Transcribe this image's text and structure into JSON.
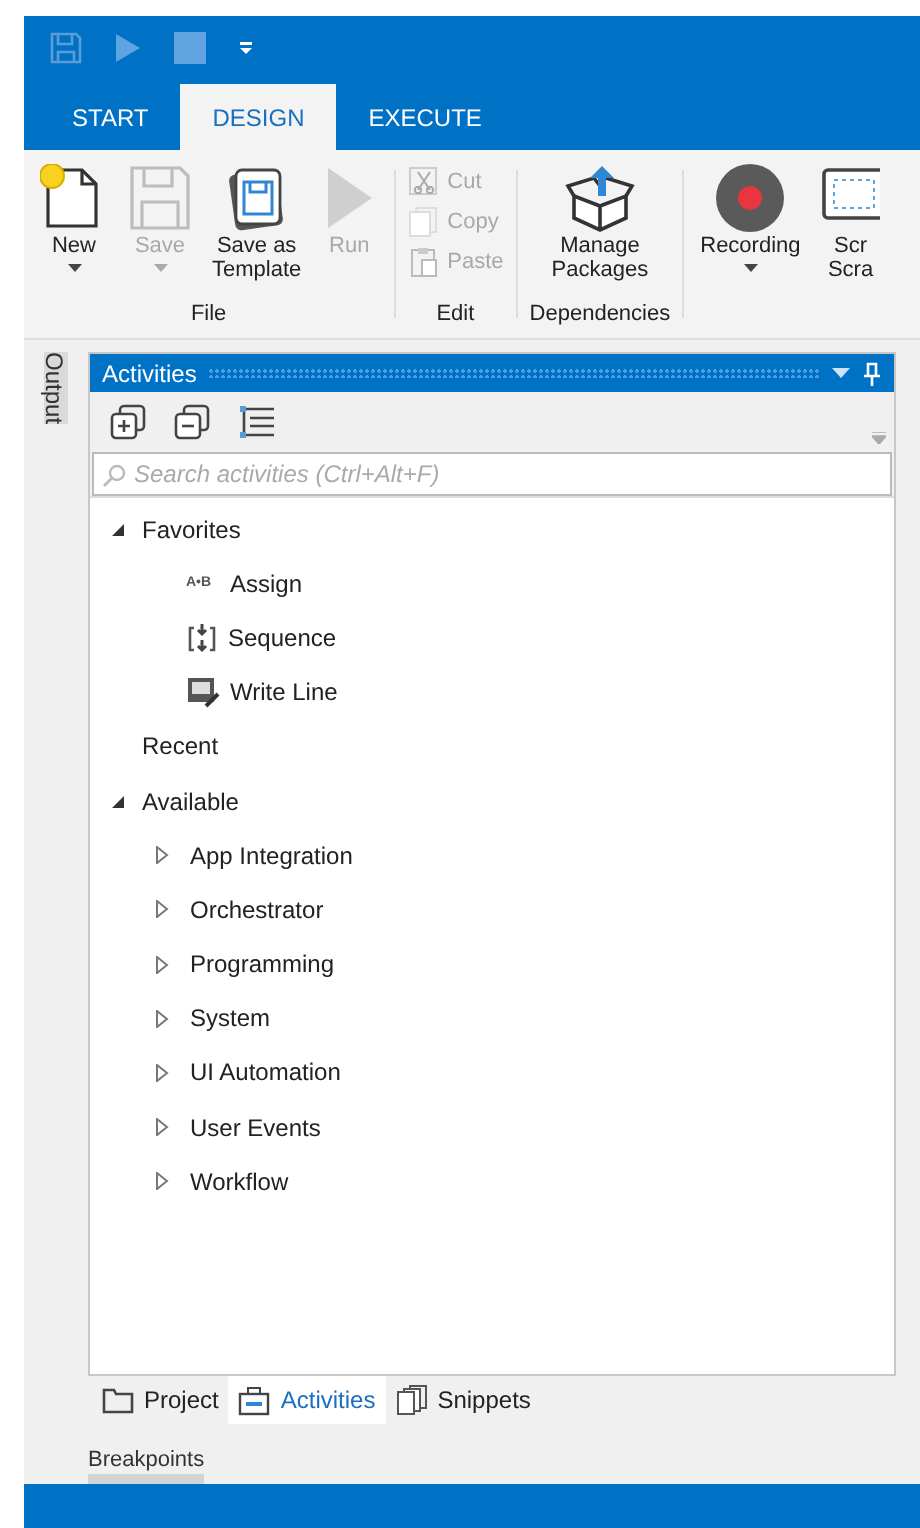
{
  "tabs": [
    {
      "label": "START",
      "selected": false
    },
    {
      "label": "DESIGN",
      "selected": true
    },
    {
      "label": "EXECUTE",
      "selected": false
    }
  ],
  "ribbon": {
    "groups": [
      {
        "label": "File",
        "buttons": [
          {
            "kind": "new",
            "label": "New",
            "disabled": false,
            "dropdown": true
          },
          {
            "kind": "save",
            "label": "Save",
            "disabled": true,
            "dropdown": true
          },
          {
            "kind": "template",
            "label": "Save as\nTemplate",
            "disabled": false,
            "dropdown": false
          },
          {
            "kind": "run",
            "label": "Run",
            "disabled": true,
            "dropdown": false
          }
        ]
      },
      {
        "label": "Edit",
        "small_buttons": [
          {
            "kind": "cut",
            "label": "Cut",
            "disabled": true
          },
          {
            "kind": "copy",
            "label": "Copy",
            "disabled": true
          },
          {
            "kind": "paste",
            "label": "Paste",
            "disabled": true
          }
        ]
      },
      {
        "label": "Dependencies",
        "buttons": [
          {
            "kind": "packages",
            "label": "Manage\nPackages",
            "disabled": false,
            "dropdown": false
          }
        ]
      },
      {
        "buttons": [
          {
            "kind": "record",
            "label": "Recording",
            "disabled": false,
            "dropdown": true
          },
          {
            "kind": "screen",
            "label": "Scr\nScra",
            "disabled": false,
            "dropdown": false
          }
        ]
      }
    ]
  },
  "side_tab": "Output",
  "panel": {
    "title": "Activities",
    "search": {
      "placeholder": "Search activities (Ctrl+Alt+F)"
    },
    "tree": [
      {
        "label": "Favorites",
        "expanded": true,
        "children": [
          {
            "label": "Assign",
            "kind": "assign",
            "badge": "A•B"
          },
          {
            "label": "Sequence",
            "kind": "sequence"
          },
          {
            "label": "Write Line",
            "kind": "writeline"
          }
        ]
      },
      {
        "label": "Recent"
      },
      {
        "label": "Available",
        "expanded": true,
        "children": [
          {
            "label": "App Integration",
            "expanded": false
          },
          {
            "label": "Orchestrator",
            "expanded": false
          },
          {
            "label": "Programming",
            "expanded": false
          },
          {
            "label": "System",
            "expanded": false
          },
          {
            "label": "UI Automation",
            "expanded": false
          },
          {
            "label": "User Events",
            "expanded": false
          },
          {
            "label": "Workflow",
            "expanded": false
          }
        ]
      }
    ]
  },
  "bottom_tabs": [
    {
      "label": "Project",
      "kind": "project",
      "selected": false
    },
    {
      "label": "Activities",
      "kind": "activities",
      "selected": true
    },
    {
      "label": "Snippets",
      "kind": "snippets",
      "selected": false
    }
  ],
  "breakpoints": "Breakpoints"
}
